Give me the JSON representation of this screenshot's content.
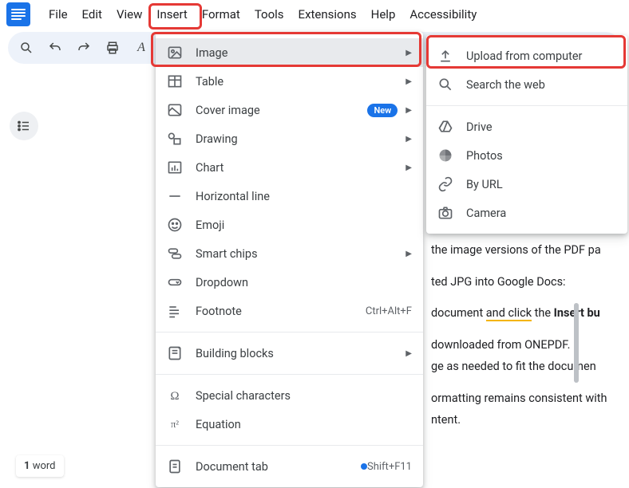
{
  "menubar": {
    "items": [
      "File",
      "Edit",
      "View",
      "Insert",
      "Format",
      "Tools",
      "Extensions",
      "Help",
      "Accessibility"
    ]
  },
  "insert_menu": {
    "items": [
      {
        "icon": "image-icon",
        "label": "Image",
        "arrow": true,
        "highlight": true
      },
      {
        "icon": "table-icon",
        "label": "Table",
        "arrow": true
      },
      {
        "icon": "cover-image-icon",
        "label": "Cover image",
        "arrow": true,
        "badge": "New"
      },
      {
        "icon": "drawing-icon",
        "label": "Drawing",
        "arrow": true
      },
      {
        "icon": "chart-icon",
        "label": "Chart",
        "arrow": true
      },
      {
        "icon": "hr-icon",
        "label": "Horizontal line"
      },
      {
        "icon": "emoji-icon",
        "label": "Emoji"
      },
      {
        "icon": "chips-icon",
        "label": "Smart chips",
        "arrow": true
      },
      {
        "icon": "dropdown-icon",
        "label": "Dropdown"
      },
      {
        "icon": "footnote-icon",
        "label": "Footnote",
        "shortcut": "Ctrl+Alt+F"
      },
      {
        "sep": true
      },
      {
        "icon": "blocks-icon",
        "label": "Building blocks",
        "arrow": true
      },
      {
        "sep": true
      },
      {
        "icon": "omega-icon",
        "label": "Special characters"
      },
      {
        "icon": "pi-icon",
        "label": "Equation"
      },
      {
        "sep": true
      },
      {
        "icon": "doctab-icon",
        "label": "Document tab",
        "dot": true,
        "shortcut": "Shift+F11"
      }
    ]
  },
  "image_submenu": {
    "items": [
      {
        "icon": "upload-icon",
        "label": "Upload from computer"
      },
      {
        "icon": "search-icon",
        "label": "Search the web"
      },
      {
        "sep": true
      },
      {
        "icon": "drive-icon",
        "label": "Drive"
      },
      {
        "icon": "photos-icon",
        "label": "Photos"
      },
      {
        "icon": "url-icon",
        "label": "By URL"
      },
      {
        "icon": "camera-icon",
        "label": "Camera"
      }
    ]
  },
  "background_doc": {
    "l1": "the image versions of the PDF pa",
    "l2": "ted JPG into Google Docs:",
    "l3a": "document ",
    "l3b": "and click",
    "l3c": " the ",
    "l3d": "Insert bu",
    "l4": "downloaded from ONEPDF.",
    "l5": "ge as needed to fit the documen",
    "l6": "ormatting remains consistent with",
    "l7": "ntent."
  },
  "word_count": {
    "n": "1",
    "label": " word"
  }
}
